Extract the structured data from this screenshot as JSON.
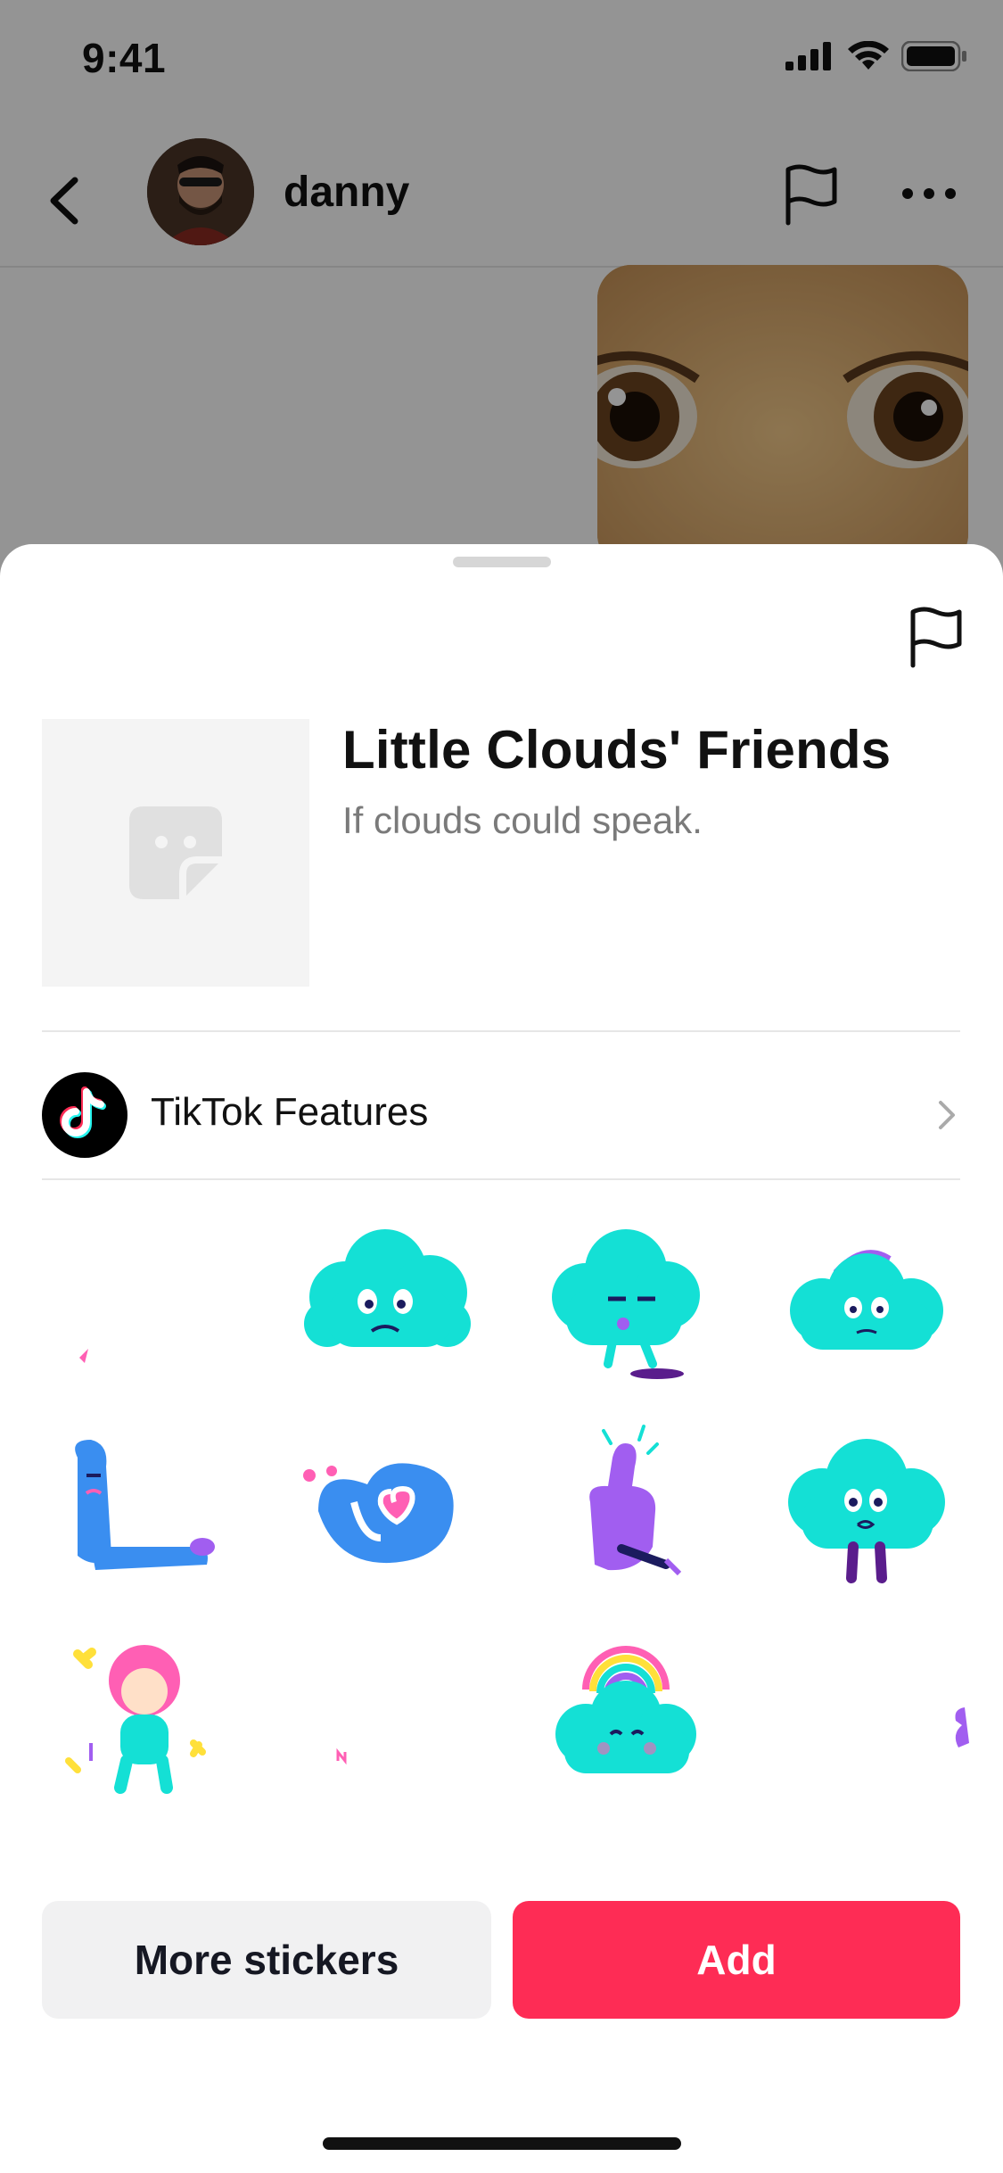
{
  "status_bar": {
    "time": "9:41",
    "icons": [
      "cellular-icon",
      "wifi-icon",
      "battery-icon"
    ]
  },
  "chat_header": {
    "username": "danny",
    "icons": [
      "back-icon",
      "flag-icon",
      "more-icon"
    ]
  },
  "sheet": {
    "pack_title": "Little Clouds' Friends",
    "pack_subtitle": "If clouds could speak.",
    "features_label": "TikTok Features",
    "stickers": [
      {
        "name": "sticker-1"
      },
      {
        "name": "sticker-2"
      },
      {
        "name": "sticker-3"
      },
      {
        "name": "sticker-4"
      },
      {
        "name": "sticker-5"
      },
      {
        "name": "sticker-6"
      },
      {
        "name": "sticker-7"
      },
      {
        "name": "sticker-8"
      },
      {
        "name": "sticker-9"
      },
      {
        "name": "sticker-10"
      },
      {
        "name": "sticker-11"
      },
      {
        "name": "sticker-12"
      }
    ],
    "more_button_label": "More stickers",
    "add_button_label": "Add"
  },
  "colors": {
    "accent": "#fe2c55",
    "secondary_button": "#f1f1f2",
    "sticker_cyan": "#14e0d5",
    "sticker_blue": "#3a8ef0",
    "sticker_purple": "#a15ef0",
    "sticker_pink": "#ff5fb4"
  }
}
